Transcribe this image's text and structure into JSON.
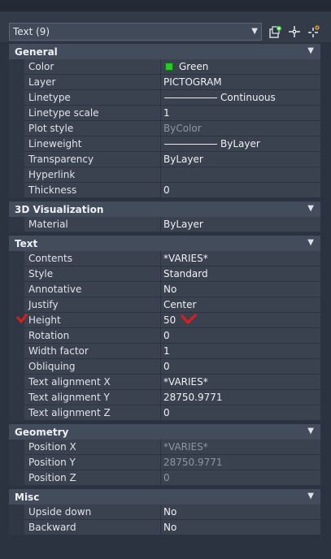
{
  "toolbar": {
    "selection": "Text (9)",
    "buttons": [
      "quick-select-icon",
      "select-objects-icon",
      "toggle-pickadd-icon"
    ]
  },
  "sections": {
    "general": {
      "title": "General",
      "rows": [
        {
          "name": "Color",
          "value": "Green",
          "swatch": "#22cc22"
        },
        {
          "name": "Layer",
          "value": "PICTOGRAM"
        },
        {
          "name": "Linetype",
          "value": "Continuous"
        },
        {
          "name": "Linetype scale",
          "value": "1"
        },
        {
          "name": "Plot style",
          "value": "ByColor"
        },
        {
          "name": "Lineweight",
          "value": "ByLayer"
        },
        {
          "name": "Transparency",
          "value": "ByLayer"
        },
        {
          "name": "Hyperlink",
          "value": ""
        },
        {
          "name": "Thickness",
          "value": "0"
        }
      ]
    },
    "viz3d": {
      "title": "3D Visualization",
      "rows": [
        {
          "name": "Material",
          "value": "ByLayer"
        }
      ]
    },
    "text": {
      "title": "Text",
      "rows": [
        {
          "name": "Contents",
          "value": "*VARIES*"
        },
        {
          "name": "Style",
          "value": "Standard"
        },
        {
          "name": "Annotative",
          "value": "No"
        },
        {
          "name": "Justify",
          "value": "Center"
        },
        {
          "name": "Height",
          "value": "50"
        },
        {
          "name": "Rotation",
          "value": "0"
        },
        {
          "name": "Width factor",
          "value": "1"
        },
        {
          "name": "Obliquing",
          "value": "0"
        },
        {
          "name": "Text alignment X",
          "value": "*VARIES*"
        },
        {
          "name": "Text alignment Y",
          "value": "28750.9771"
        },
        {
          "name": "Text alignment Z",
          "value": "0"
        }
      ]
    },
    "geometry": {
      "title": "Geometry",
      "rows": [
        {
          "name": "Position X",
          "value": "*VARIES*"
        },
        {
          "name": "Position Y",
          "value": "28750.9771"
        },
        {
          "name": "Position Z",
          "value": "0"
        }
      ]
    },
    "misc": {
      "title": "Misc",
      "rows": [
        {
          "name": "Upside down",
          "value": "No"
        },
        {
          "name": "Backward",
          "value": "No"
        }
      ]
    }
  },
  "annotations": {
    "color": "#e01b1b"
  }
}
